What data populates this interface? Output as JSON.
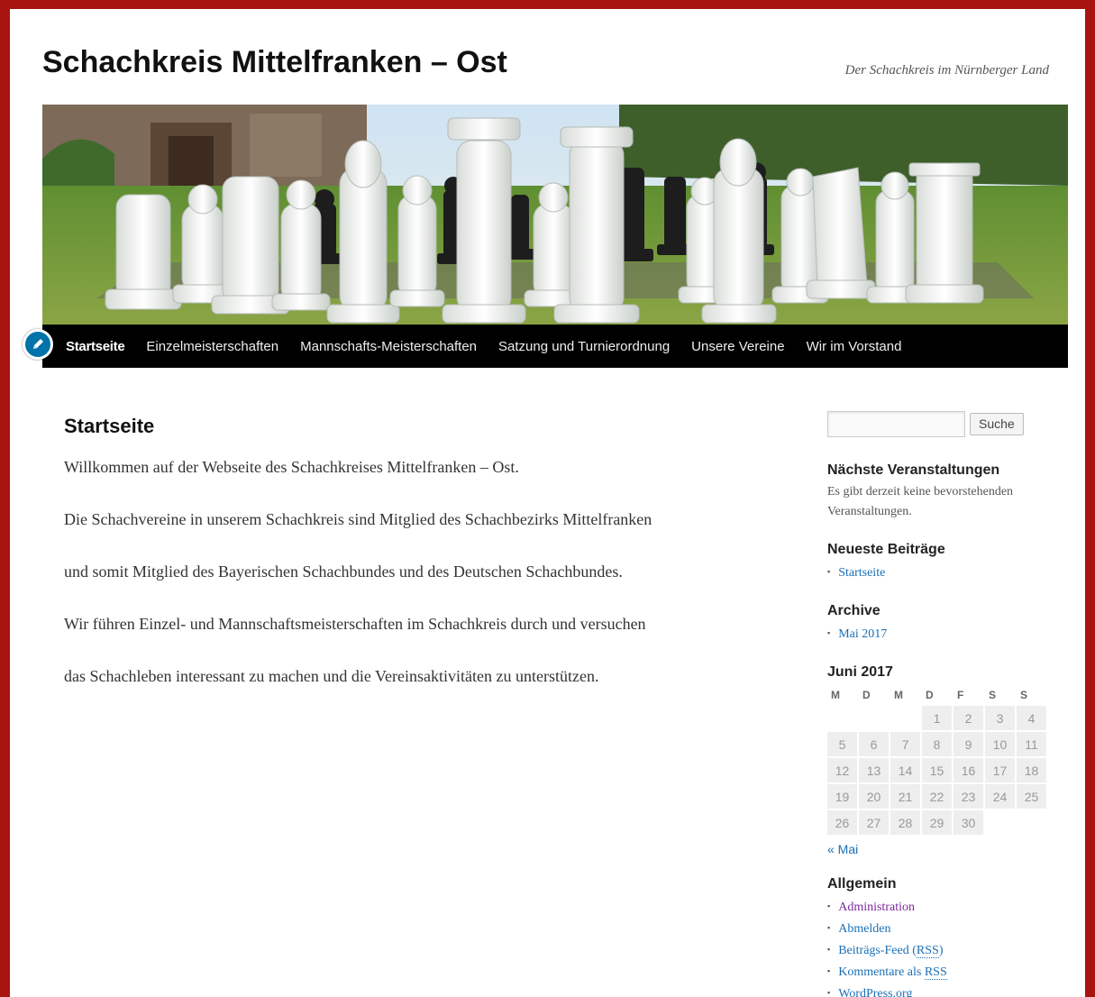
{
  "site": {
    "title": "Schachkreis Mittelfranken – Ost",
    "description": "Der Schachkreis im Nürnberger Land"
  },
  "nav": {
    "items": [
      {
        "label": "Startseite",
        "current": true
      },
      {
        "label": "Einzelmeisterschaften"
      },
      {
        "label": "Mannschafts-Meisterschaften"
      },
      {
        "label": "Satzung und Turnierordnung"
      },
      {
        "label": "Unsere Vereine"
      },
      {
        "label": "Wir im Vorstand"
      }
    ]
  },
  "header_icons": {
    "edit": "pencil-icon"
  },
  "content": {
    "title": "Startseite",
    "paragraphs": [
      "Willkommen auf der Webseite des Schachkreises Mittelfranken – Ost.",
      "Die Schachvereine in unserem Schachkreis sind Mitglied des Schachbezirks Mittelfranken",
      "und somit Mitglied des Bayerischen Schachbundes und des Deutschen Schachbundes.",
      "Wir führen Einzel- und Mannschaftsmeisterschaften im Schachkreis durch und versuchen",
      "das Schachleben interessant zu machen und die Vereinsaktivitäten zu unterstützen."
    ]
  },
  "sidebar": {
    "search": {
      "value": "",
      "button": "Suche"
    },
    "events": {
      "title": "Nächste Veranstaltungen",
      "text": "Es gibt derzeit keine bevorstehenden Veranstaltungen."
    },
    "recent": {
      "title": "Neueste Beiträge",
      "items": [
        "Startseite"
      ]
    },
    "archive": {
      "title": "Archive",
      "items": [
        "Mai 2017"
      ]
    },
    "calendar": {
      "title": "Juni 2017",
      "weekdays": [
        "M",
        "D",
        "M",
        "D",
        "F",
        "S",
        "S"
      ],
      "weeks": [
        [
          "",
          "",
          "",
          "1",
          "2",
          "3",
          "4"
        ],
        [
          "5",
          "6",
          "7",
          "8",
          "9",
          "10",
          "11"
        ],
        [
          "12",
          "13",
          "14",
          "15",
          "16",
          "17",
          "18"
        ],
        [
          "19",
          "20",
          "21",
          "22",
          "23",
          "24",
          "25"
        ],
        [
          "26",
          "27",
          "28",
          "29",
          "30",
          "",
          ""
        ]
      ],
      "prev": "« Mai"
    },
    "meta": {
      "title": "Allgemein",
      "admin": "Administration",
      "logout": "Abmelden",
      "feed_prefix": "Beiträgs-Feed (",
      "feed_abbr": "RSS",
      "feed_suffix": ")",
      "comments_prefix": "Kommentare als ",
      "comments_abbr": "RSS",
      "wordpress": "WordPress.org"
    }
  },
  "colors": {
    "frame": "#a8140f",
    "nav_bg": "#000000",
    "link": "#1a6fb5",
    "visited": "#7b2a9c"
  }
}
